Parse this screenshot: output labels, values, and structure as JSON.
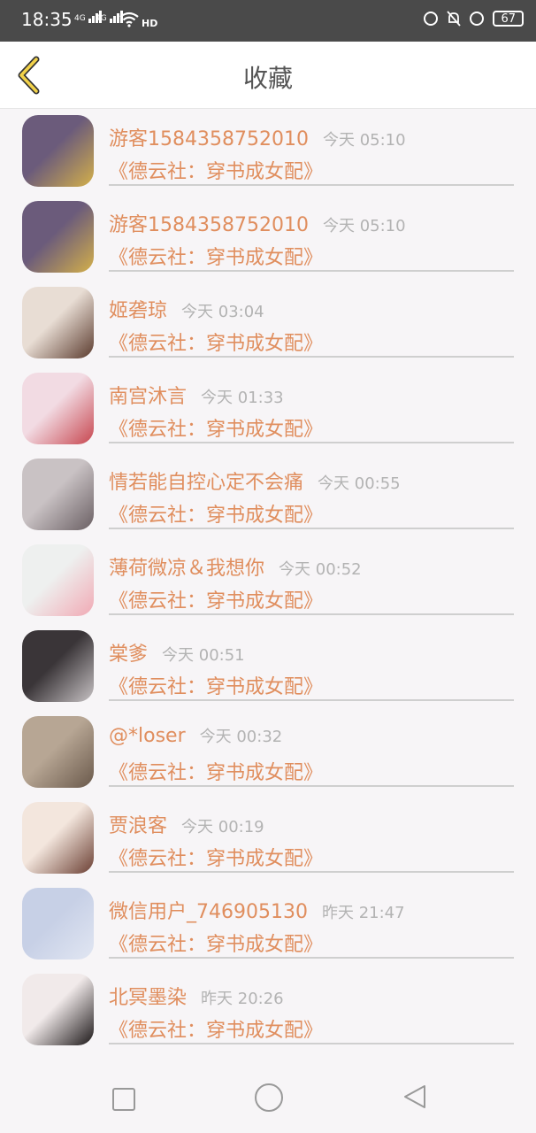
{
  "status": {
    "time": "18:35",
    "network1": "4G",
    "network2": "4G",
    "wifi": "HD",
    "battery": "67"
  },
  "header": {
    "title": "收藏"
  },
  "items": [
    {
      "name": "游客1584358752010",
      "time": "今天 05:10",
      "book": "《德云社：穿书成女配》",
      "avatar_colors": [
        "#6b5b7b",
        "#d4b04a"
      ]
    },
    {
      "name": "游客1584358752010",
      "time": "今天 05:10",
      "book": "《德云社：穿书成女配》",
      "avatar_colors": [
        "#6b5b7b",
        "#d4b04a"
      ]
    },
    {
      "name": "姬砻琼",
      "time": "今天 03:04",
      "book": "《德云社：穿书成女配》",
      "avatar_colors": [
        "#e8ddd4",
        "#5b3b2e"
      ]
    },
    {
      "name": "南宫沐言",
      "time": "今天 01:33",
      "book": "《德云社：穿书成女配》",
      "avatar_colors": [
        "#f2dbe3",
        "#c7464f"
      ]
    },
    {
      "name": "情若能自控心定不会痛",
      "time": "今天 00:55",
      "book": "《德云社：穿书成女配》",
      "avatar_colors": [
        "#c9c2c4",
        "#6a5f63"
      ]
    },
    {
      "name": "薄荷微凉＆我想你",
      "time": "今天 00:52",
      "book": "《德云社：穿书成女配》",
      "avatar_colors": [
        "#eef0ef",
        "#f1a9b4"
      ]
    },
    {
      "name": "棠爹",
      "time": "今天 00:51",
      "book": "《德云社：穿书成女配》",
      "avatar_colors": [
        "#3a3538",
        "#c7c2c4"
      ]
    },
    {
      "name": "@*loser",
      "time": "今天 00:32",
      "book": "《德云社：穿书成女配》",
      "avatar_colors": [
        "#b7a694",
        "#6a594b"
      ]
    },
    {
      "name": "贾浪客",
      "time": "今天 00:19",
      "book": "《德云社：穿书成女配》",
      "avatar_colors": [
        "#f3e6dd",
        "#6b3f33"
      ]
    },
    {
      "name": "微信用户_746905130",
      "time": "昨天 21:47",
      "book": "《德云社：穿书成女配》",
      "avatar_colors": [
        "#c7d0e6",
        "#e1e6f2"
      ]
    },
    {
      "name": "北冥墨染",
      "time": "昨天 20:26",
      "book": "《德云社：穿书成女配》",
      "avatar_colors": [
        "#f1eaea",
        "#1c1718"
      ]
    }
  ],
  "partial_item": {
    "avatar_colors": [
      "#3a6a9a",
      "#9db6d1"
    ]
  }
}
